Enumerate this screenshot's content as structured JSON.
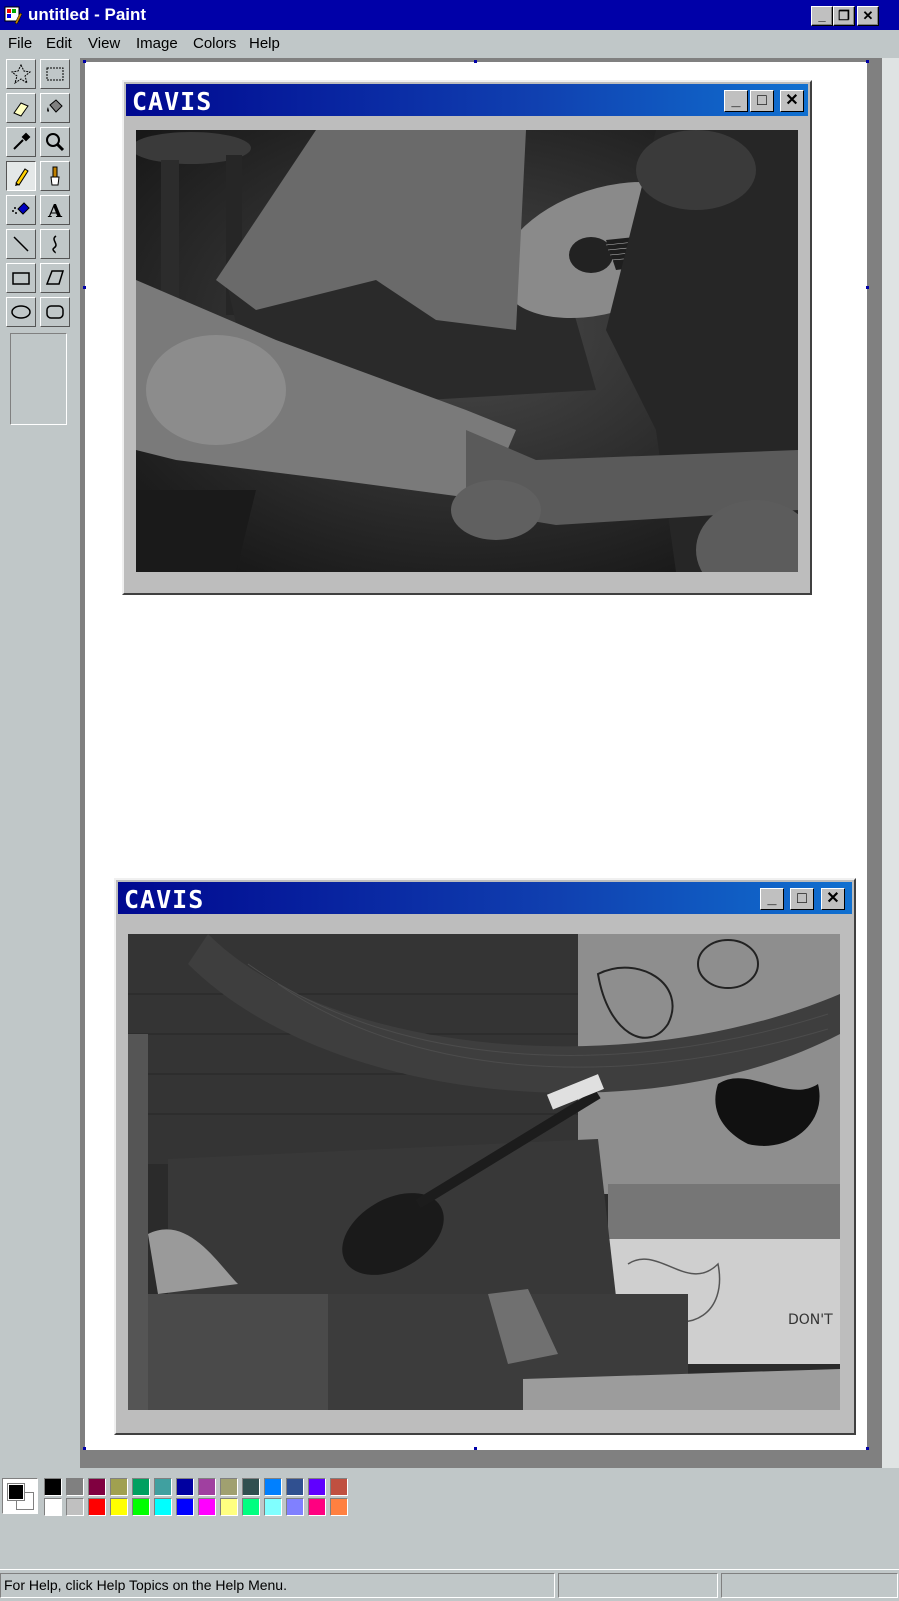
{
  "window": {
    "title": "untitled - Paint",
    "minimize_label": "_",
    "restore_label": "❐",
    "close_label": "✕"
  },
  "menu": {
    "items": [
      {
        "label": "File"
      },
      {
        "label": "Edit"
      },
      {
        "label": "View"
      },
      {
        "label": "Image"
      },
      {
        "label": "Colors"
      },
      {
        "label": "Help"
      }
    ]
  },
  "tools": [
    "free-form-select-icon",
    "rect-select-icon",
    "eraser-icon",
    "fill-icon",
    "color-picker-icon",
    "magnifier-icon",
    "pencil-icon",
    "brush-icon",
    "airbrush-icon",
    "text-icon",
    "line-icon",
    "curve-icon",
    "rectangle-icon",
    "polygon-icon",
    "ellipse-icon",
    "rounded-rectangle-icon"
  ],
  "active_tool": "pencil-icon",
  "canvas_windows": [
    {
      "title": "CAVIS",
      "minimize_label": "_",
      "maximize_label": "□",
      "close_label": "✕",
      "photo": "grayscale photo: person in ripped jeans holding leg, guitarist with acoustic guitar"
    },
    {
      "title": "CAVIS",
      "minimize_label": "_",
      "maximize_label": "□",
      "close_label": "✕",
      "photo": "grayscale photo: acoustic guitar resting on couch, hammock and graffiti wall",
      "graffiti_text": "DON'T"
    }
  ],
  "palette": {
    "foreground": "#000000",
    "background": "#ffffff",
    "top_row": [
      "#000000",
      "#808080",
      "#800040",
      "#a0a050",
      "#00a060",
      "#40a0a0",
      "#0000a0",
      "#a040a0",
      "#a0a070",
      "#305050",
      "#0080ff",
      "#305090",
      "#6000ff",
      "#c05040"
    ],
    "bottom_row": [
      "#ffffff",
      "#c0c0c0",
      "#ff0000",
      "#ffff00",
      "#00ff00",
      "#00ffff",
      "#0000ff",
      "#ff00ff",
      "#ffff80",
      "#00ff80",
      "#80ffff",
      "#8080ff",
      "#ff0080",
      "#ff8040"
    ]
  },
  "status": {
    "help_text": "For Help, click Help Topics on the Help Menu."
  }
}
